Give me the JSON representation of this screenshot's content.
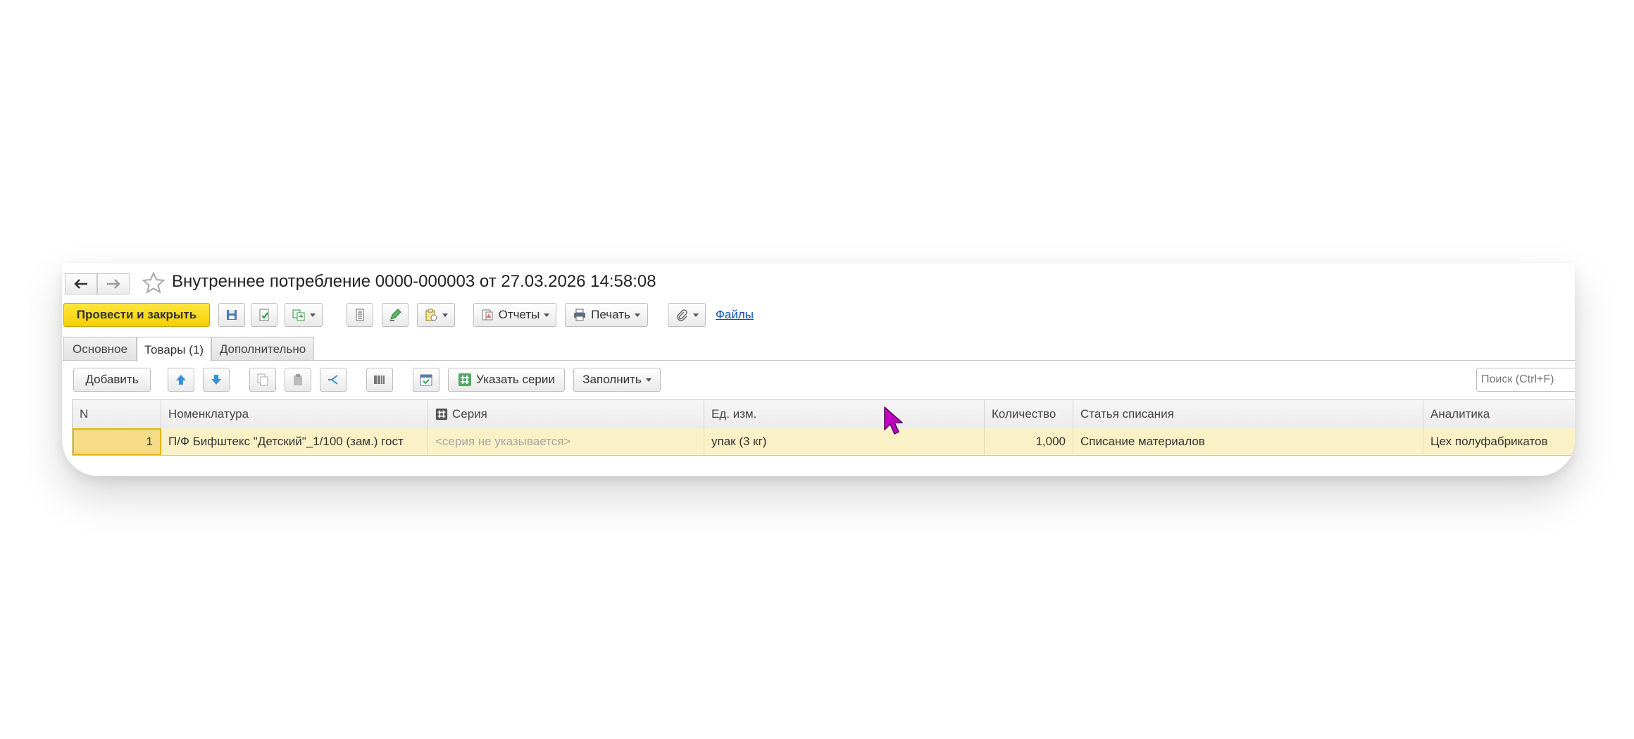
{
  "window": {
    "title": "Внутреннее потребление 0000-000003 от 27.03.2026 14:58:08"
  },
  "toolbar": {
    "post_and_close": "Провести и закрыть",
    "reports": "Отчеты",
    "print": "Печать",
    "files": "Файлы"
  },
  "tabs": [
    {
      "label": "Основное"
    },
    {
      "label": "Товары (1)"
    },
    {
      "label": "Дополнительно"
    }
  ],
  "goods_toolbar": {
    "add": "Добавить",
    "specify_series": "Указать серии",
    "fill": "Заполнить",
    "search_placeholder": "Поиск (Ctrl+F)"
  },
  "table": {
    "columns": [
      "N",
      "Номенклатура",
      "Серия",
      "Ед. изм.",
      "Количество",
      "Статья списания",
      "Аналитика"
    ],
    "rows": [
      {
        "n": "1",
        "item": "П/Ф Бифштекс \"Детский\"_1/100 (зам.) гост",
        "series": "<серия не указывается>",
        "unit": "упак (3 кг)",
        "quantity": "1,000",
        "writeoff_article": "Списание материалов",
        "analytics": "Цех полуфабрикатов"
      }
    ]
  },
  "colors": {
    "primary_button": "#f5d000",
    "selected_row": "#fbf1c6",
    "link": "#0d4fbf",
    "cursor": "#c000c0"
  }
}
